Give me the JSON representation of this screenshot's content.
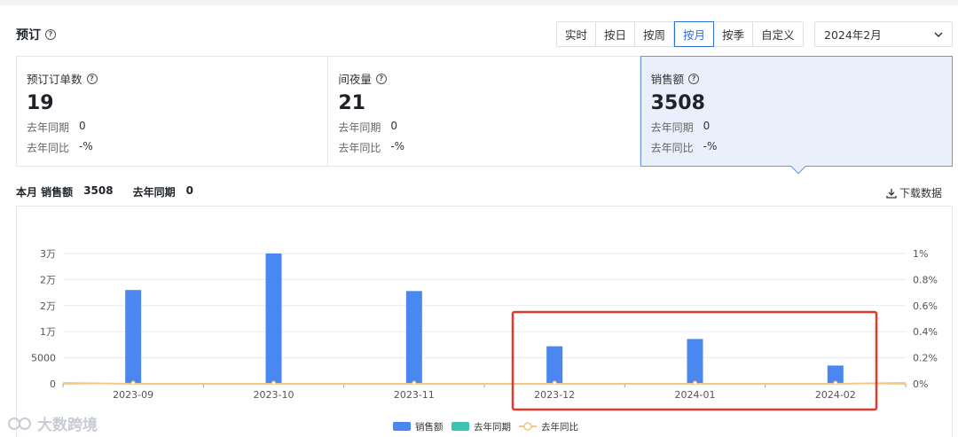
{
  "header": {
    "title": "预订"
  },
  "tabs": [
    {
      "label": "实时",
      "active": false
    },
    {
      "label": "按日",
      "active": false
    },
    {
      "label": "按周",
      "active": false
    },
    {
      "label": "按月",
      "active": true
    },
    {
      "label": "按季",
      "active": false
    },
    {
      "label": "自定义",
      "active": false
    }
  ],
  "date_select": {
    "value": "2024年2月"
  },
  "cards": [
    {
      "label": "预订订单数",
      "value": "19",
      "last_year_label": "去年同期",
      "last_year_value": "0",
      "yoy_label": "去年同比",
      "yoy_value": "-%"
    },
    {
      "label": "间夜量",
      "value": "21",
      "last_year_label": "去年同期",
      "last_year_value": "0",
      "yoy_label": "去年同比",
      "yoy_value": "-%"
    },
    {
      "label": "销售额",
      "value": "3508",
      "last_year_label": "去年同期",
      "last_year_value": "0",
      "yoy_label": "去年同比",
      "yoy_value": "-%"
    }
  ],
  "summary": {
    "period_label": "本月 销售额",
    "period_value": "3508",
    "last_year_label": "去年同期",
    "last_year_value": "0"
  },
  "download_label": "下载数据",
  "watermark": "大数跨境",
  "colors": {
    "accent": "#2f6fd8",
    "bar": "#4b87f0",
    "last_year": "#3cc1b2",
    "yoy": "#f6c77f",
    "highlight_box": "#e03a2f"
  },
  "chart_data": {
    "type": "bar",
    "categories": [
      "2023-09",
      "2023-10",
      "2023-11",
      "2023-12",
      "2024-01",
      "2024-02"
    ],
    "series": [
      {
        "name": "销售额",
        "type": "bar",
        "values": [
          18000,
          25000,
          17800,
          7200,
          8600,
          3508
        ]
      },
      {
        "name": "去年同期",
        "type": "bar",
        "values": [
          0,
          0,
          0,
          0,
          0,
          0
        ]
      },
      {
        "name": "去年同比",
        "type": "line",
        "axis": "right",
        "values": [
          0,
          0,
          0,
          0,
          0,
          0
        ]
      }
    ],
    "y_left_ticks": [
      "0",
      "5000",
      "1万",
      "2万",
      "2万",
      "3万"
    ],
    "y_left_range": [
      0,
      25000
    ],
    "y_right_ticks": [
      "0%",
      "0.2%",
      "0.4%",
      "0.6%",
      "0.8%",
      "1%"
    ],
    "y_right_range": [
      0,
      1
    ],
    "grid": true,
    "legend": "bottom-center",
    "highlight_categories": [
      "2023-12",
      "2024-01",
      "2024-02"
    ]
  }
}
